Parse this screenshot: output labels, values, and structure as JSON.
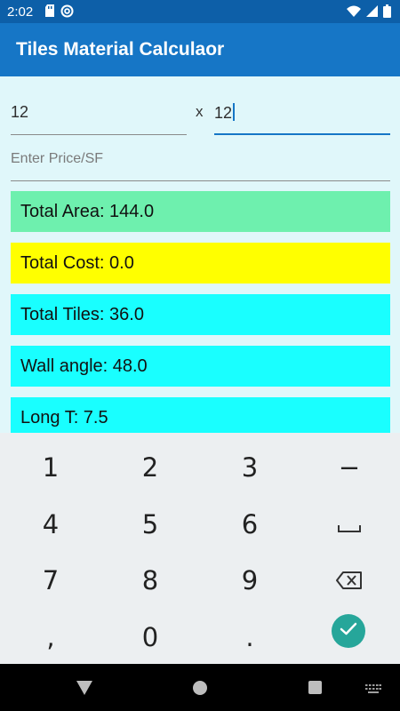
{
  "status_bar": {
    "time": "2:02",
    "left_icons": [
      "sd-card-icon",
      "at-sign-icon"
    ],
    "right_icons": [
      "wifi-icon",
      "cell-signal-icon",
      "battery-icon"
    ]
  },
  "app_bar": {
    "title": "Tiles Material Calculaor"
  },
  "form": {
    "dimension_1_value": "12",
    "times_symbol": "x",
    "dimension_2_value": "12",
    "price_placeholder": "Enter Price/SF"
  },
  "results": {
    "total_area": "Total Area: 144.0",
    "total_cost": "Total Cost: 0.0",
    "total_tiles": "Total Tiles: 36.0",
    "wall_angle": "Wall angle: 48.0",
    "long_t": "Long T: 7.5"
  },
  "result_colors": {
    "area": "#6ef0ae",
    "cost": "#ffff00",
    "tiles": "#19ffff"
  },
  "keyboard": {
    "row1": [
      "1",
      "2",
      "3",
      "−"
    ],
    "row2": [
      "4",
      "5",
      "6"
    ],
    "row3": [
      "7",
      "8",
      "9"
    ],
    "row4": [
      ",",
      "0",
      "."
    ],
    "space_icon": "space-icon",
    "backspace_icon": "backspace-icon",
    "done_icon": "checkmark-icon"
  },
  "nav_bar": {
    "back_icon": "back-triangle-icon",
    "home_icon": "home-circle-icon",
    "recents_icon": "recents-square-icon",
    "keyboard_icon": "keyboard-grid-icon"
  },
  "colors": {
    "status_bar": "#0d5fa8",
    "app_bar": "#1676c6",
    "background": "#e0f7fa",
    "keyboard": "#eceff1",
    "done_button": "#26a69a"
  }
}
